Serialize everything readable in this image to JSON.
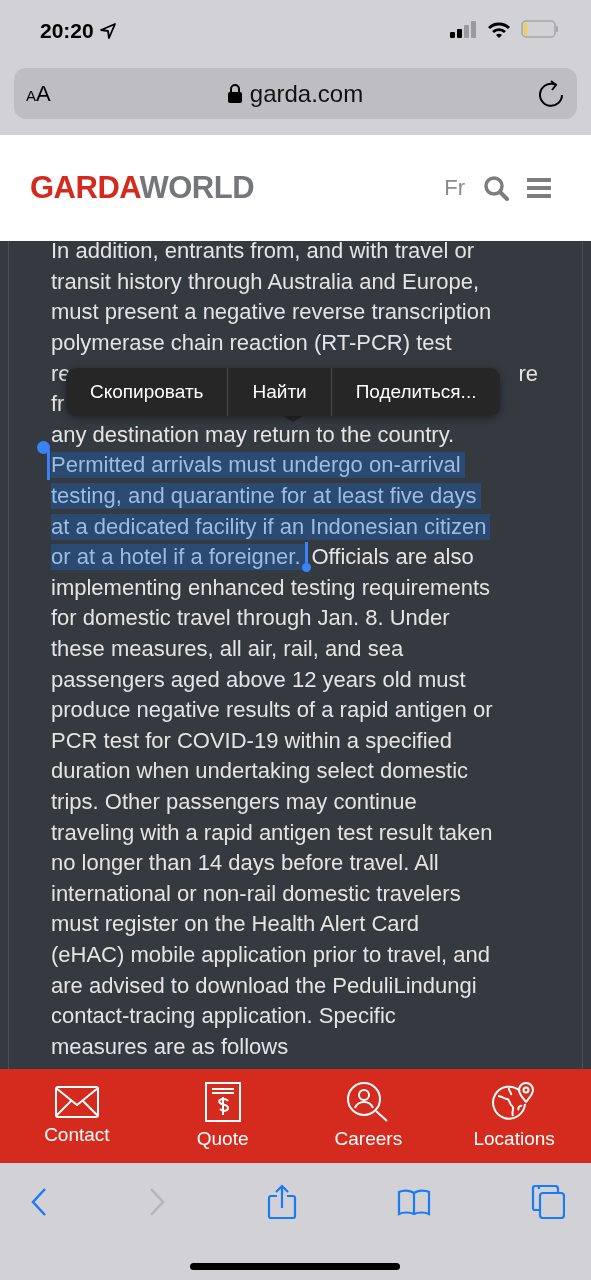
{
  "status_bar": {
    "time": "20:20"
  },
  "address_bar": {
    "text_size_label": "AA",
    "url": "garda.com"
  },
  "header": {
    "logo_first": "GARDA",
    "logo_second": "WORLD",
    "language": "Fr"
  },
  "article": {
    "lines": [
      {
        "segments": [
          {
            "text": "In addition, entrants from, and with travel or",
            "selected": false
          }
        ]
      },
      {
        "segments": [
          {
            "text": "transit history through Australia and Europe,",
            "selected": false
          }
        ]
      },
      {
        "segments": [
          {
            "text": "must present a negative reverse transcription",
            "selected": false
          }
        ]
      },
      {
        "segments": [
          {
            "text": "polymerase chain reaction (RT-PCR) test",
            "selected": false
          }
        ]
      },
      {
        "kind": "covered",
        "segments": [
          {
            "text": "re",
            "selected": false
          },
          {
            "text": "re",
            "selected": false
          }
        ]
      },
      {
        "segments": [
          {
            "text": "fr",
            "selected": false
          }
        ]
      },
      {
        "segments": [
          {
            "text": "any destination may return to the country.",
            "selected": false
          }
        ]
      },
      {
        "segments": [
          {
            "text": "Permitted arrivals must undergo on-arrival",
            "selected": true
          }
        ]
      },
      {
        "segments": [
          {
            "text": "testing, and quarantine for at least five days",
            "selected": true
          }
        ]
      },
      {
        "segments": [
          {
            "text": "at a dedicated facility if an Indonesian citizen",
            "selected": true
          }
        ]
      },
      {
        "segments": [
          {
            "text": "or at a hotel if a foreigner.",
            "selected": true
          },
          {
            "text": "Officials are also",
            "selected": false
          }
        ]
      },
      {
        "segments": [
          {
            "text": "implementing enhanced testing requirements",
            "selected": false
          }
        ]
      },
      {
        "segments": [
          {
            "text": "for domestic travel through Jan. 8. Under",
            "selected": false
          }
        ]
      },
      {
        "segments": [
          {
            "text": "these measures, all air, rail, and sea",
            "selected": false
          }
        ]
      },
      {
        "segments": [
          {
            "text": "passengers aged above 12 years old must",
            "selected": false
          }
        ]
      },
      {
        "segments": [
          {
            "text": "produce negative results of a rapid antigen or",
            "selected": false
          }
        ]
      },
      {
        "segments": [
          {
            "text": "PCR test for COVID-19 within a specified",
            "selected": false
          }
        ]
      },
      {
        "segments": [
          {
            "text": "duration when undertaking select domestic",
            "selected": false
          }
        ]
      },
      {
        "segments": [
          {
            "text": "trips. Other passengers may continue",
            "selected": false
          }
        ]
      },
      {
        "segments": [
          {
            "text": "traveling with a rapid antigen test result taken",
            "selected": false
          }
        ]
      },
      {
        "segments": [
          {
            "text": "no longer than 14 days before travel. All",
            "selected": false
          }
        ]
      },
      {
        "segments": [
          {
            "text": "international or non-rail domestic travelers",
            "selected": false
          }
        ]
      },
      {
        "segments": [
          {
            "text": "must register on the Health Alert Card",
            "selected": false
          }
        ]
      },
      {
        "segments": [
          {
            "text": "(eHAC) mobile application prior to travel, and",
            "selected": false
          }
        ]
      },
      {
        "segments": [
          {
            "text": "are advised to download the PeduliLindungi",
            "selected": false
          }
        ]
      },
      {
        "segments": [
          {
            "text": "contact-tracing application. Specific",
            "selected": false
          }
        ]
      },
      {
        "segments": [
          {
            "text": "measures are as follows",
            "selected": false
          }
        ]
      }
    ]
  },
  "context_menu": {
    "items": [
      "Скопировать",
      "Найти",
      "Поделиться..."
    ]
  },
  "action_bar": {
    "items": [
      {
        "kind": "mail",
        "label": "Contact"
      },
      {
        "kind": "quote",
        "label": "Quote"
      },
      {
        "kind": "careers",
        "label": "Careers"
      },
      {
        "kind": "locations",
        "label": "Locations"
      }
    ]
  },
  "toolbar": {
    "items": [
      {
        "kind": "back",
        "disabled": false
      },
      {
        "kind": "forward",
        "disabled": true
      },
      {
        "kind": "share",
        "disabled": false
      },
      {
        "kind": "bookmarks",
        "disabled": false
      },
      {
        "kind": "tabs",
        "disabled": false
      }
    ]
  }
}
